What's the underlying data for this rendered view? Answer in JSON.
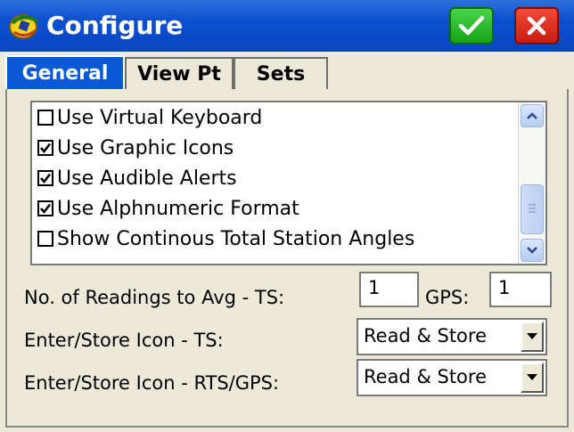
{
  "window": {
    "title": "Configure"
  },
  "tabs": [
    {
      "label": "General",
      "active": true
    },
    {
      "label": "View Pt",
      "active": false
    },
    {
      "label": "Sets",
      "active": false
    }
  ],
  "options": [
    {
      "label": "Use Virtual Keyboard",
      "checked": false
    },
    {
      "label": "Use Graphic Icons",
      "checked": true
    },
    {
      "label": "Use Audible Alerts",
      "checked": true
    },
    {
      "label": "Use Alphnumeric Format",
      "checked": true
    },
    {
      "label": "Show Continous Total Station Angles",
      "checked": false
    }
  ],
  "readings": {
    "label": "No. of Readings to Avg  -  TS:",
    "ts_value": "1",
    "gps_label": "GPS:",
    "gps_value": "1"
  },
  "enter_store_ts": {
    "label": "Enter/Store Icon - TS:",
    "value": "Read & Store"
  },
  "enter_store_rts": {
    "label": "Enter/Store Icon - RTS/GPS:",
    "value": "Read & Store"
  },
  "colors": {
    "title_bar": "#0b4fd0",
    "ok": "#16a316",
    "close": "#c91c10",
    "tab_active": "#0b59d6"
  }
}
